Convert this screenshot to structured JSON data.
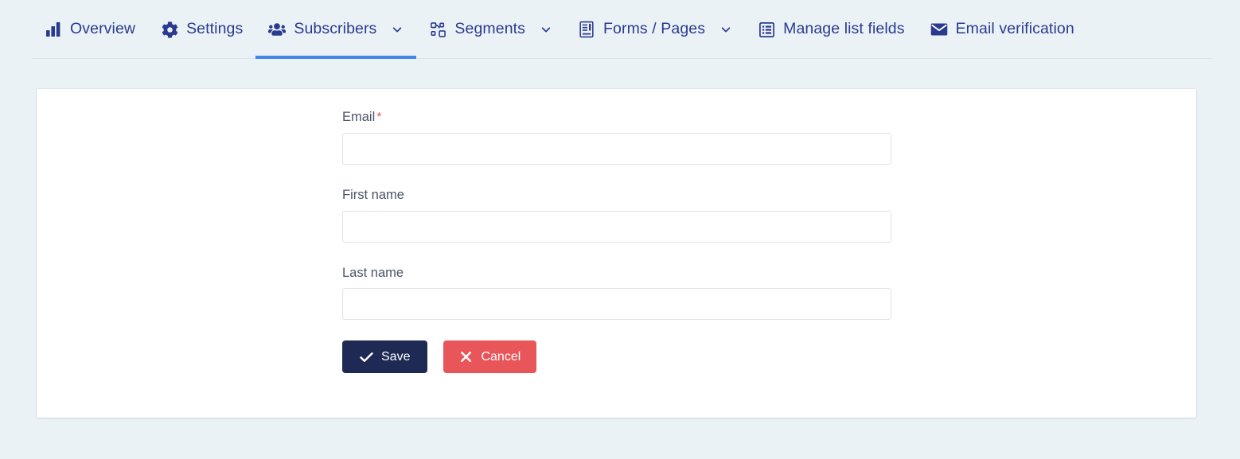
{
  "theme": {
    "page_background": "#ebf2f6",
    "card_background": "#ffffff",
    "tab_text": "#2a3a8f",
    "active_tab_underline": "#4285ec",
    "input_border": "#dde2ee",
    "label_text": "#4a5568",
    "required_marker": "#e8565a",
    "save_button": "#1e2a54",
    "cancel_button": "#e8565a"
  },
  "tabs": [
    {
      "label": "Overview",
      "icon": "bar-chart-icon",
      "caret": false,
      "active": false
    },
    {
      "label": "Settings",
      "icon": "gear-icon",
      "caret": false,
      "active": false
    },
    {
      "label": "Subscribers",
      "icon": "users-icon",
      "caret": true,
      "active": true
    },
    {
      "label": "Segments",
      "icon": "sitemap-icon",
      "caret": true,
      "active": false
    },
    {
      "label": "Forms / Pages",
      "icon": "form-icon",
      "caret": true,
      "active": false
    },
    {
      "label": "Manage list fields",
      "icon": "table-list-icon",
      "caret": false,
      "active": false
    },
    {
      "label": "Email verification",
      "icon": "envelope-icon",
      "caret": false,
      "active": false
    }
  ],
  "form": {
    "fields": [
      {
        "label": "Email",
        "required": true,
        "required_marker": "*",
        "value": "",
        "placeholder": ""
      },
      {
        "label": "First name",
        "required": false,
        "required_marker": "",
        "value": "",
        "placeholder": ""
      },
      {
        "label": "Last name",
        "required": false,
        "required_marker": "",
        "value": "",
        "placeholder": ""
      }
    ],
    "buttons": {
      "save": {
        "label": "Save",
        "icon": "check-icon"
      },
      "cancel": {
        "label": "Cancel",
        "icon": "x-icon"
      }
    }
  }
}
